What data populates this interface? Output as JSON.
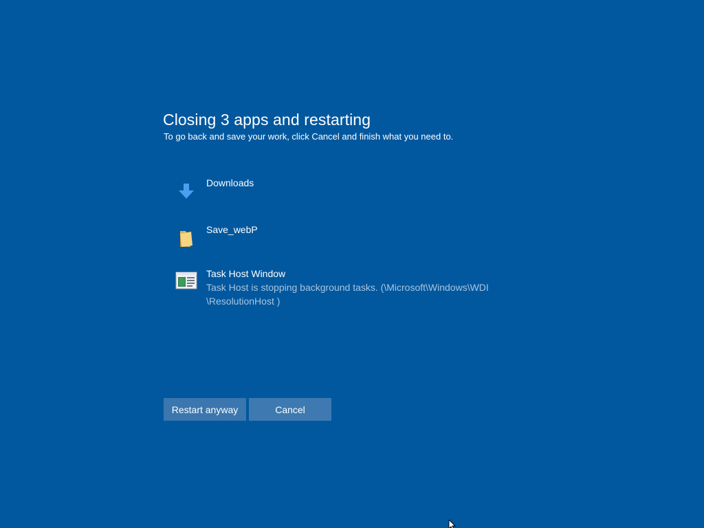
{
  "dialog": {
    "title": "Closing 3 apps and restarting",
    "subtitle": "To go back and save your work, click Cancel and finish what you need to."
  },
  "apps": [
    {
      "name": "Downloads",
      "description": "",
      "icon": "download-arrow-icon"
    },
    {
      "name": "Save_webP",
      "description": "",
      "icon": "folder-icon"
    },
    {
      "name": "Task Host Window",
      "description": "Task Host is stopping background tasks. (\\Microsoft\\Windows\\WDI \\ResolutionHost )",
      "icon": "task-host-window-icon"
    }
  ],
  "buttons": {
    "restart_label": "Restart anyway",
    "cancel_label": "Cancel"
  },
  "colors": {
    "background": "#02589f",
    "button": "#3b76ae",
    "secondary_text": "#a9c4df"
  }
}
